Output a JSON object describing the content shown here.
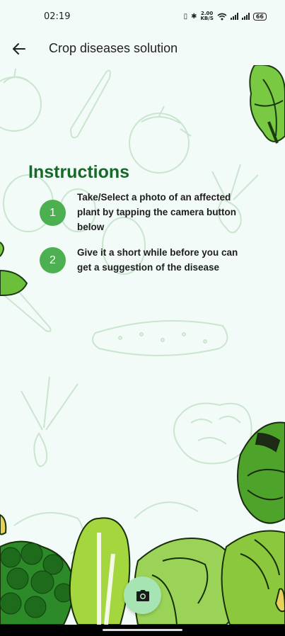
{
  "status_bar": {
    "time": "02:19",
    "net_speed_value": "2.00",
    "net_speed_unit": "KB/S",
    "battery": "66"
  },
  "app_bar": {
    "title": "Crop diseases solution",
    "back_icon": "arrow-left-icon"
  },
  "instructions": {
    "title": "Instructions",
    "steps": [
      {
        "number": "1",
        "text": "Take/Select a photo of an affected plant by tapping the camera button below"
      },
      {
        "number": "2",
        "text": "Give it a short while before you can get a suggestion of the disease"
      }
    ]
  },
  "fab": {
    "icon": "camera-icon"
  },
  "colors": {
    "background": "#f2fbf7",
    "accent": "#4caf50",
    "title_green": "#17692a",
    "fab": "#a7e4b4"
  }
}
